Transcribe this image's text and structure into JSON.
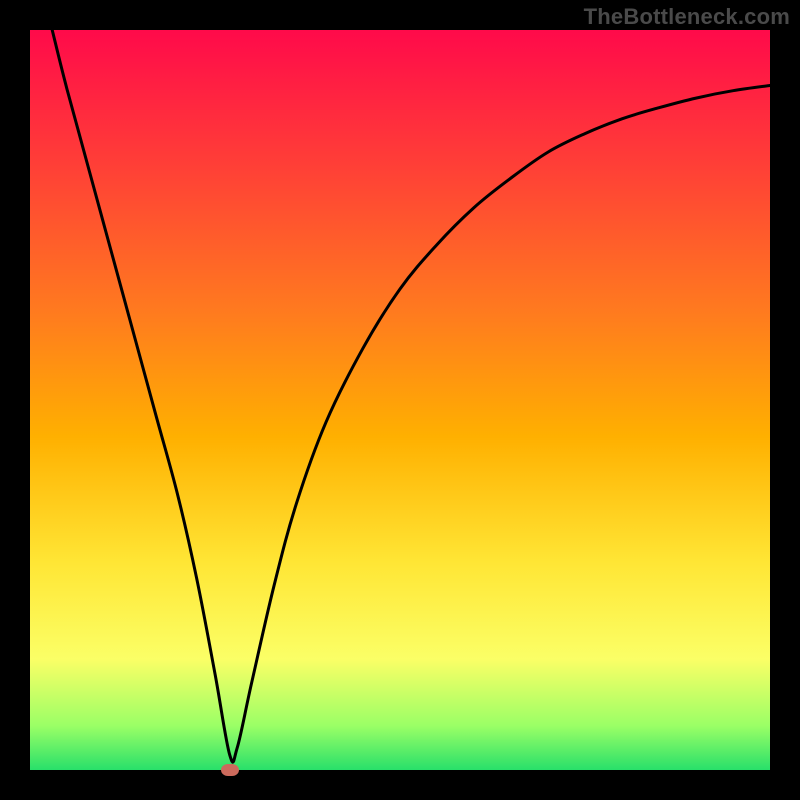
{
  "watermark": "TheBottleneck.com",
  "colors": {
    "frame": "#000000",
    "watermark": "#4a4a4a",
    "curve": "#000000",
    "marker": "#cc6a5c",
    "gradient": [
      "#ff0a4a",
      "#ff3e37",
      "#ff7a1f",
      "#ffb000",
      "#ffe635",
      "#fbff66",
      "#9bff66",
      "#28e06a"
    ]
  },
  "chart_data": {
    "type": "line",
    "title": "",
    "xlabel": "",
    "ylabel": "",
    "xlim": [
      0,
      100
    ],
    "ylim": [
      0,
      100
    ],
    "series": [
      {
        "name": "bottleneck-curve",
        "x": [
          3,
          5,
          8,
          11,
          14,
          17,
          20,
          22.5,
          25,
          27,
          28,
          30,
          33,
          36,
          40,
          45,
          50,
          55,
          60,
          65,
          70,
          75,
          80,
          85,
          90,
          95,
          100
        ],
        "values": [
          100,
          92,
          81,
          70,
          59,
          48,
          37,
          26,
          13,
          2,
          3,
          12,
          25,
          36,
          47,
          57,
          65,
          71,
          76,
          80,
          83.5,
          86,
          88,
          89.5,
          90.8,
          91.8,
          92.5
        ]
      }
    ],
    "marker": {
      "x": 27,
      "y": 0,
      "name": "optimal-point"
    }
  }
}
